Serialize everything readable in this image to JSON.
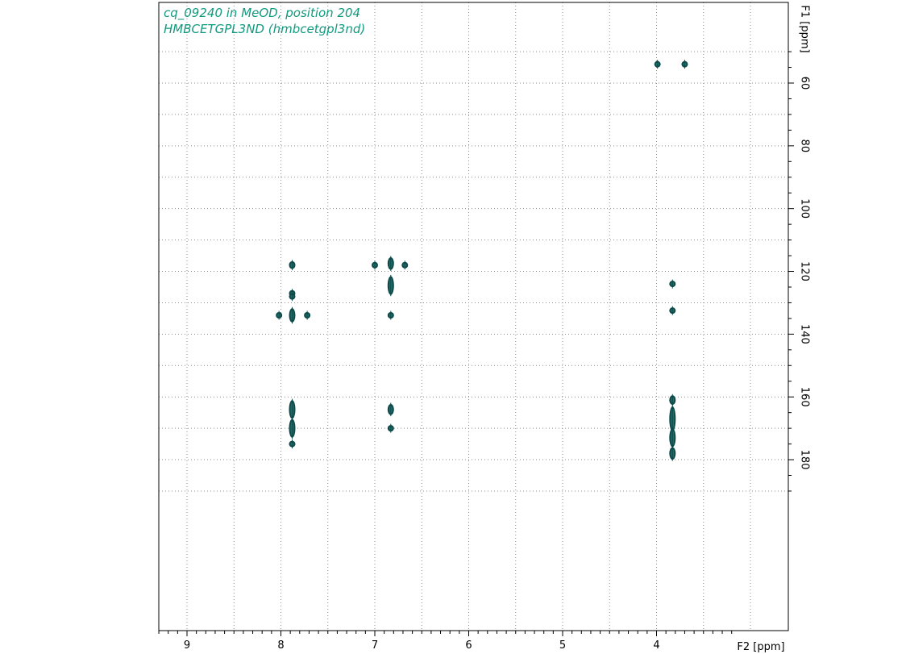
{
  "chart_data": {
    "type": "scatter",
    "subtype": "2D NMR contour plot",
    "title_lines": [
      "cq_09240 in MeOD, position 204",
      "HMBCETGPL3ND (hmbcetgpl3nd)"
    ],
    "xlabel": "F2 [ppm]",
    "ylabel": "F1 [ppm]",
    "x_axis": {
      "reversed": true,
      "range": [
        9.3,
        8.0
      ],
      "ticks": [
        9,
        8,
        7,
        6,
        5,
        4
      ]
    },
    "y_axis": {
      "reversed": true,
      "range": [
        48,
        190
      ],
      "ticks": [
        60,
        80,
        100,
        120,
        140,
        160,
        180
      ],
      "position": "right"
    },
    "grid": true,
    "contour_color": "#0d4a4a",
    "peaks": [
      {
        "x": 3.99,
        "y": 54.0,
        "len": 2.0
      },
      {
        "x": 3.7,
        "y": 54.0,
        "len": 2.0
      },
      {
        "x": 7.88,
        "y": 118.0,
        "len": 2.5
      },
      {
        "x": 7.88,
        "y": 127.0,
        "len": 2.0
      },
      {
        "x": 7.88,
        "y": 128.0,
        "len": 1.0
      },
      {
        "x": 8.02,
        "y": 134.0,
        "len": 1.5
      },
      {
        "x": 7.88,
        "y": 134.0,
        "len": 4.5
      },
      {
        "x": 7.72,
        "y": 134.0,
        "len": 1.5
      },
      {
        "x": 7.88,
        "y": 164.0,
        "len": 6.0
      },
      {
        "x": 7.88,
        "y": 170.0,
        "len": 6.0
      },
      {
        "x": 7.88,
        "y": 175.0,
        "len": 2.0
      },
      {
        "x": 7.0,
        "y": 118.0,
        "len": 1.5
      },
      {
        "x": 6.83,
        "y": 117.5,
        "len": 4.0
      },
      {
        "x": 6.68,
        "y": 118.0,
        "len": 1.5
      },
      {
        "x": 6.83,
        "y": 124.5,
        "len": 6.0
      },
      {
        "x": 6.83,
        "y": 134.0,
        "len": 1.5
      },
      {
        "x": 6.83,
        "y": 164.0,
        "len": 3.5
      },
      {
        "x": 6.83,
        "y": 170.0,
        "len": 2.0
      },
      {
        "x": 3.83,
        "y": 124.0,
        "len": 1.5
      },
      {
        "x": 3.83,
        "y": 132.5,
        "len": 1.5
      },
      {
        "x": 3.83,
        "y": 161.0,
        "len": 3.0
      },
      {
        "x": 3.83,
        "y": 167.0,
        "len": 8.0
      },
      {
        "x": 3.83,
        "y": 173.0,
        "len": 6.0
      },
      {
        "x": 3.83,
        "y": 178.0,
        "len": 4.0
      }
    ]
  }
}
